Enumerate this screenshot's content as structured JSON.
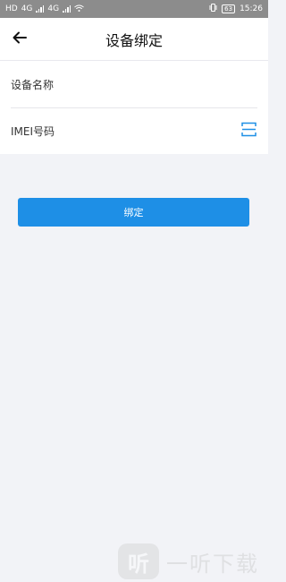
{
  "status_bar": {
    "carrier_tag": "HD",
    "network_1": "4G",
    "network_2": "4G",
    "battery": "63",
    "time": "15:26"
  },
  "header": {
    "title": "设备绑定"
  },
  "form": {
    "device_name_label": "设备名称",
    "device_name_value": "",
    "imei_label": "IMEI号码",
    "imei_value": ""
  },
  "actions": {
    "bind_label": "绑定"
  },
  "watermark": {
    "logo_glyph": "听",
    "text": "一听下载"
  },
  "colors": {
    "accent": "#1e8fe6",
    "background": "#f2f3f7"
  }
}
